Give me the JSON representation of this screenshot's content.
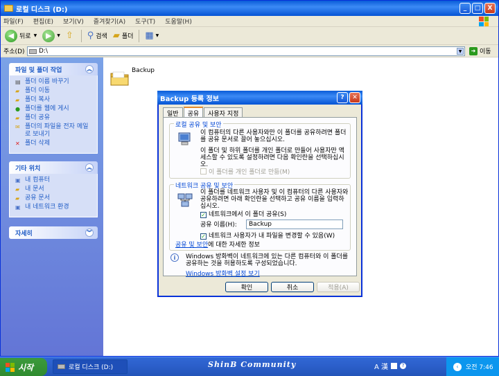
{
  "window": {
    "title": "로컬 디스크 (D:)",
    "buttons": [
      "_",
      "□",
      "X"
    ]
  },
  "menu": [
    "파일(F)",
    "편집(E)",
    "보기(V)",
    "즐겨찾기(A)",
    "도구(T)",
    "도움말(H)"
  ],
  "toolbar": {
    "back": "뒤로",
    "search": "검색",
    "folders": "폴더"
  },
  "address": {
    "label": "주소(D)",
    "value": "D:\\",
    "go": "이동"
  },
  "task_panels": {
    "file_folder": {
      "title": "파일 및 폴더 작업",
      "items": [
        "폴더 이름 바꾸기",
        "폴더 이동",
        "폴더 복사",
        "폴더를 웹에 게시",
        "폴더 공유",
        "폴더의 파일을 전자 메일로 보내기",
        "폴더 삭제"
      ]
    },
    "other_places": {
      "title": "기타 위치",
      "items": [
        "내 컴퓨터",
        "내 문서",
        "공유 문서",
        "내 네트워크 환경"
      ]
    },
    "details": {
      "title": "자세히"
    }
  },
  "folder": {
    "name": "Backup"
  },
  "dialog": {
    "title": "Backup 등록 정보",
    "tabs": [
      "일반",
      "공유",
      "사용자 지정"
    ],
    "local": {
      "title": "로컬 공유 및 보안",
      "text1": "이 컴퓨터의 다른 사용자와만 이 폴더를 공유하려면 폴더를 공유 문서로 끌어 놓으십시오.",
      "text2": "이 폴더 및 하위 폴더를 개인 폴더로 만들어 사용자만 액세스할 수 있도록 설정하려면 다음 확인란을 선택하십시오.",
      "private_checkbox": "이 폴더를 개인 폴더로 만듦(M)"
    },
    "network": {
      "title": "네트워크 공유 및 보안",
      "text": "이 폴더를 네트워크 사용자 및 이 컴퓨터의 다른 사용자와 공유하려면 아래 확인란을 선택하고 공유 이름을 입력하십시오.",
      "share_checkbox": "네트워크에서 이 폴더 공유(S)",
      "share_name_label": "공유 이름(H):",
      "share_name_value": "Backup",
      "allow_change_checkbox": "네트워크 사용자가 내 파일을 변경할 수 있음(W)",
      "more_info_link": "공유 및 보안",
      "more_info_suffix": "에 대한 자세한 정보"
    },
    "firewall": {
      "text": "Windows 방화벽이 네트워크에 있는 다른 컴퓨터와 이 폴더를 공유하는 것을 허용하도록 구성되었습니다.",
      "link": "Windows 방화벽 설정 보기"
    },
    "buttons": {
      "ok": "확인",
      "cancel": "취소",
      "apply": "적용(A)"
    }
  },
  "taskbar": {
    "start": "시작",
    "app": "로컬 디스크 (D:)",
    "watermark": "ShinB Community",
    "ime": "A 漢",
    "clock": "오전 7:46"
  },
  "colors": {
    "xp_blue": "#0a5cd8",
    "task_pane": "#6b89dd",
    "link": "#215dc6",
    "group_title": "#0046d5"
  }
}
